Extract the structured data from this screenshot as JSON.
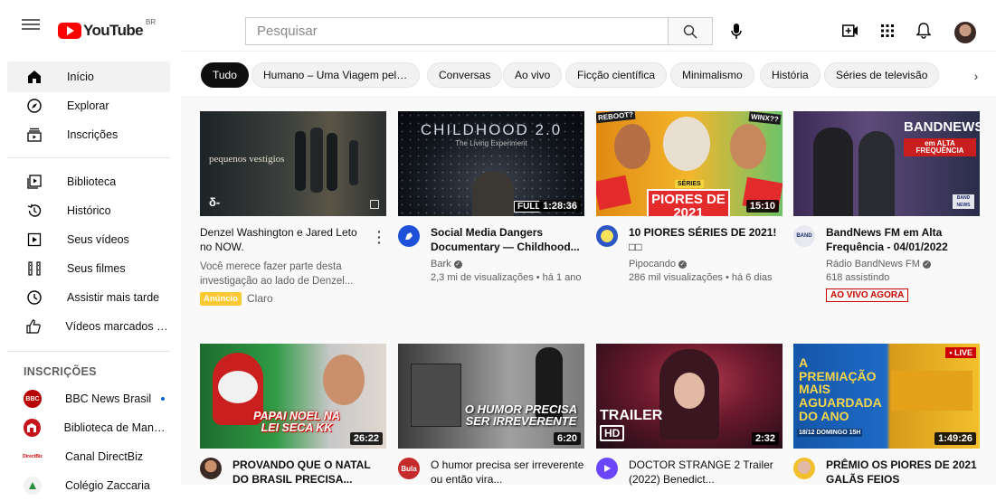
{
  "header": {
    "logo_text": "YouTube",
    "country": "BR",
    "search_placeholder": "Pesquisar"
  },
  "sidebar": {
    "items": [
      {
        "label": "Início",
        "icon": "home-icon"
      },
      {
        "label": "Explorar",
        "icon": "compass-icon"
      },
      {
        "label": "Inscrições",
        "icon": "subscriptions-icon"
      },
      {
        "label": "Biblioteca",
        "icon": "library-icon"
      },
      {
        "label": "Histórico",
        "icon": "history-icon"
      },
      {
        "label": "Seus vídeos",
        "icon": "your-videos-icon"
      },
      {
        "label": "Seus filmes",
        "icon": "movies-icon"
      },
      {
        "label": "Assistir mais tarde",
        "icon": "clock-icon"
      },
      {
        "label": "Vídeos marcados co...",
        "icon": "thumbs-up-icon"
      }
    ],
    "subscriptions_heading": "INSCRIÇÕES",
    "subscriptions": [
      {
        "label": "BBC News Brasil",
        "color": "#b80000",
        "mark": "BBC"
      },
      {
        "label": "Biblioteca de Mangui...",
        "color": "#c4141c",
        "mark": ""
      },
      {
        "label": "Canal DirectBiz",
        "color": "#ffffff",
        "mark": "DirectBiz"
      },
      {
        "label": "Colégio Zaccaria",
        "color": "#ffffff",
        "mark": ""
      }
    ]
  },
  "chips": [
    "Tudo",
    "Humano – Uma Viagem pela ...",
    "Conversas",
    "Ao vivo",
    "Ficção científica",
    "Minimalismo",
    "História",
    "Séries de televisão"
  ],
  "videos_row1": [
    {
      "title": "Denzel Washington e Jared Leto no NOW.",
      "line1": "Você merece fazer parte desta investigação ao lado de Denzel...",
      "ad_label": "Anúncio",
      "advertiser": "Claro",
      "thumb_text": "pequenos vestígios"
    },
    {
      "title": "Social Media Dangers Documentary — Childhood...",
      "channel": "Bark",
      "stats": "2,3 mi de visualizações • há 1 ano",
      "duration": "1:28:36",
      "thumb_text": "CHILDHOOD 2.0",
      "thumb_sub": "The Living Experiment",
      "thumb_badge": "FULL MOVIE"
    },
    {
      "title": "10 PIORES SÉRIES DE 2021! □□",
      "channel": "Pipocando",
      "stats": "286 mil visualizações • há 6 dias",
      "duration": "15:10",
      "thumb_text": "PIORES DE 2021",
      "thumb_tag1": "REBOOT?",
      "thumb_tag2": "WINX??",
      "thumb_tag3": "SÉRIES"
    },
    {
      "title": "BandNews FM em Alta Frequência - 04/01/2022",
      "channel": "Rádio BandNews FM",
      "stats": "618 assistindo",
      "live": "AO VIVO AGORA",
      "thumb_text": "BANDNEWS",
      "thumb_sub": "em ALTA FREQUÊNCIA"
    }
  ],
  "videos_row2": [
    {
      "title": "PROVANDO QUE O NATAL DO BRASIL PRECISA...",
      "duration": "26:22",
      "thumb_text": "PAPAI NOEL NA LEI SECA KK"
    },
    {
      "title": "O humor precisa ser irreverente ou então vira...",
      "duration": "6:20",
      "thumb_text": "O HUMOR PRECISA SER IRREVERENTE",
      "channel_mark": "Bula"
    },
    {
      "title": "DOCTOR STRANGE 2 Trailer (2022) Benedict...",
      "duration": "2:32",
      "thumb_text": "TRAILER",
      "thumb_sub": "HD"
    },
    {
      "title": "PRÊMIO OS PIORES DE 2021 GALÃS FEIOS",
      "duration": "1:49:26",
      "thumb_text": "A PREMIAÇÃO MAIS AGUARDADA DO ANO",
      "thumb_badge": "• LIVE",
      "thumb_date": "18/12 DOMINGO 15H"
    }
  ],
  "colors": {
    "accent": "#ff0000",
    "live": "#cc0000",
    "ad": "#fcc935",
    "link": "#065fd4"
  }
}
